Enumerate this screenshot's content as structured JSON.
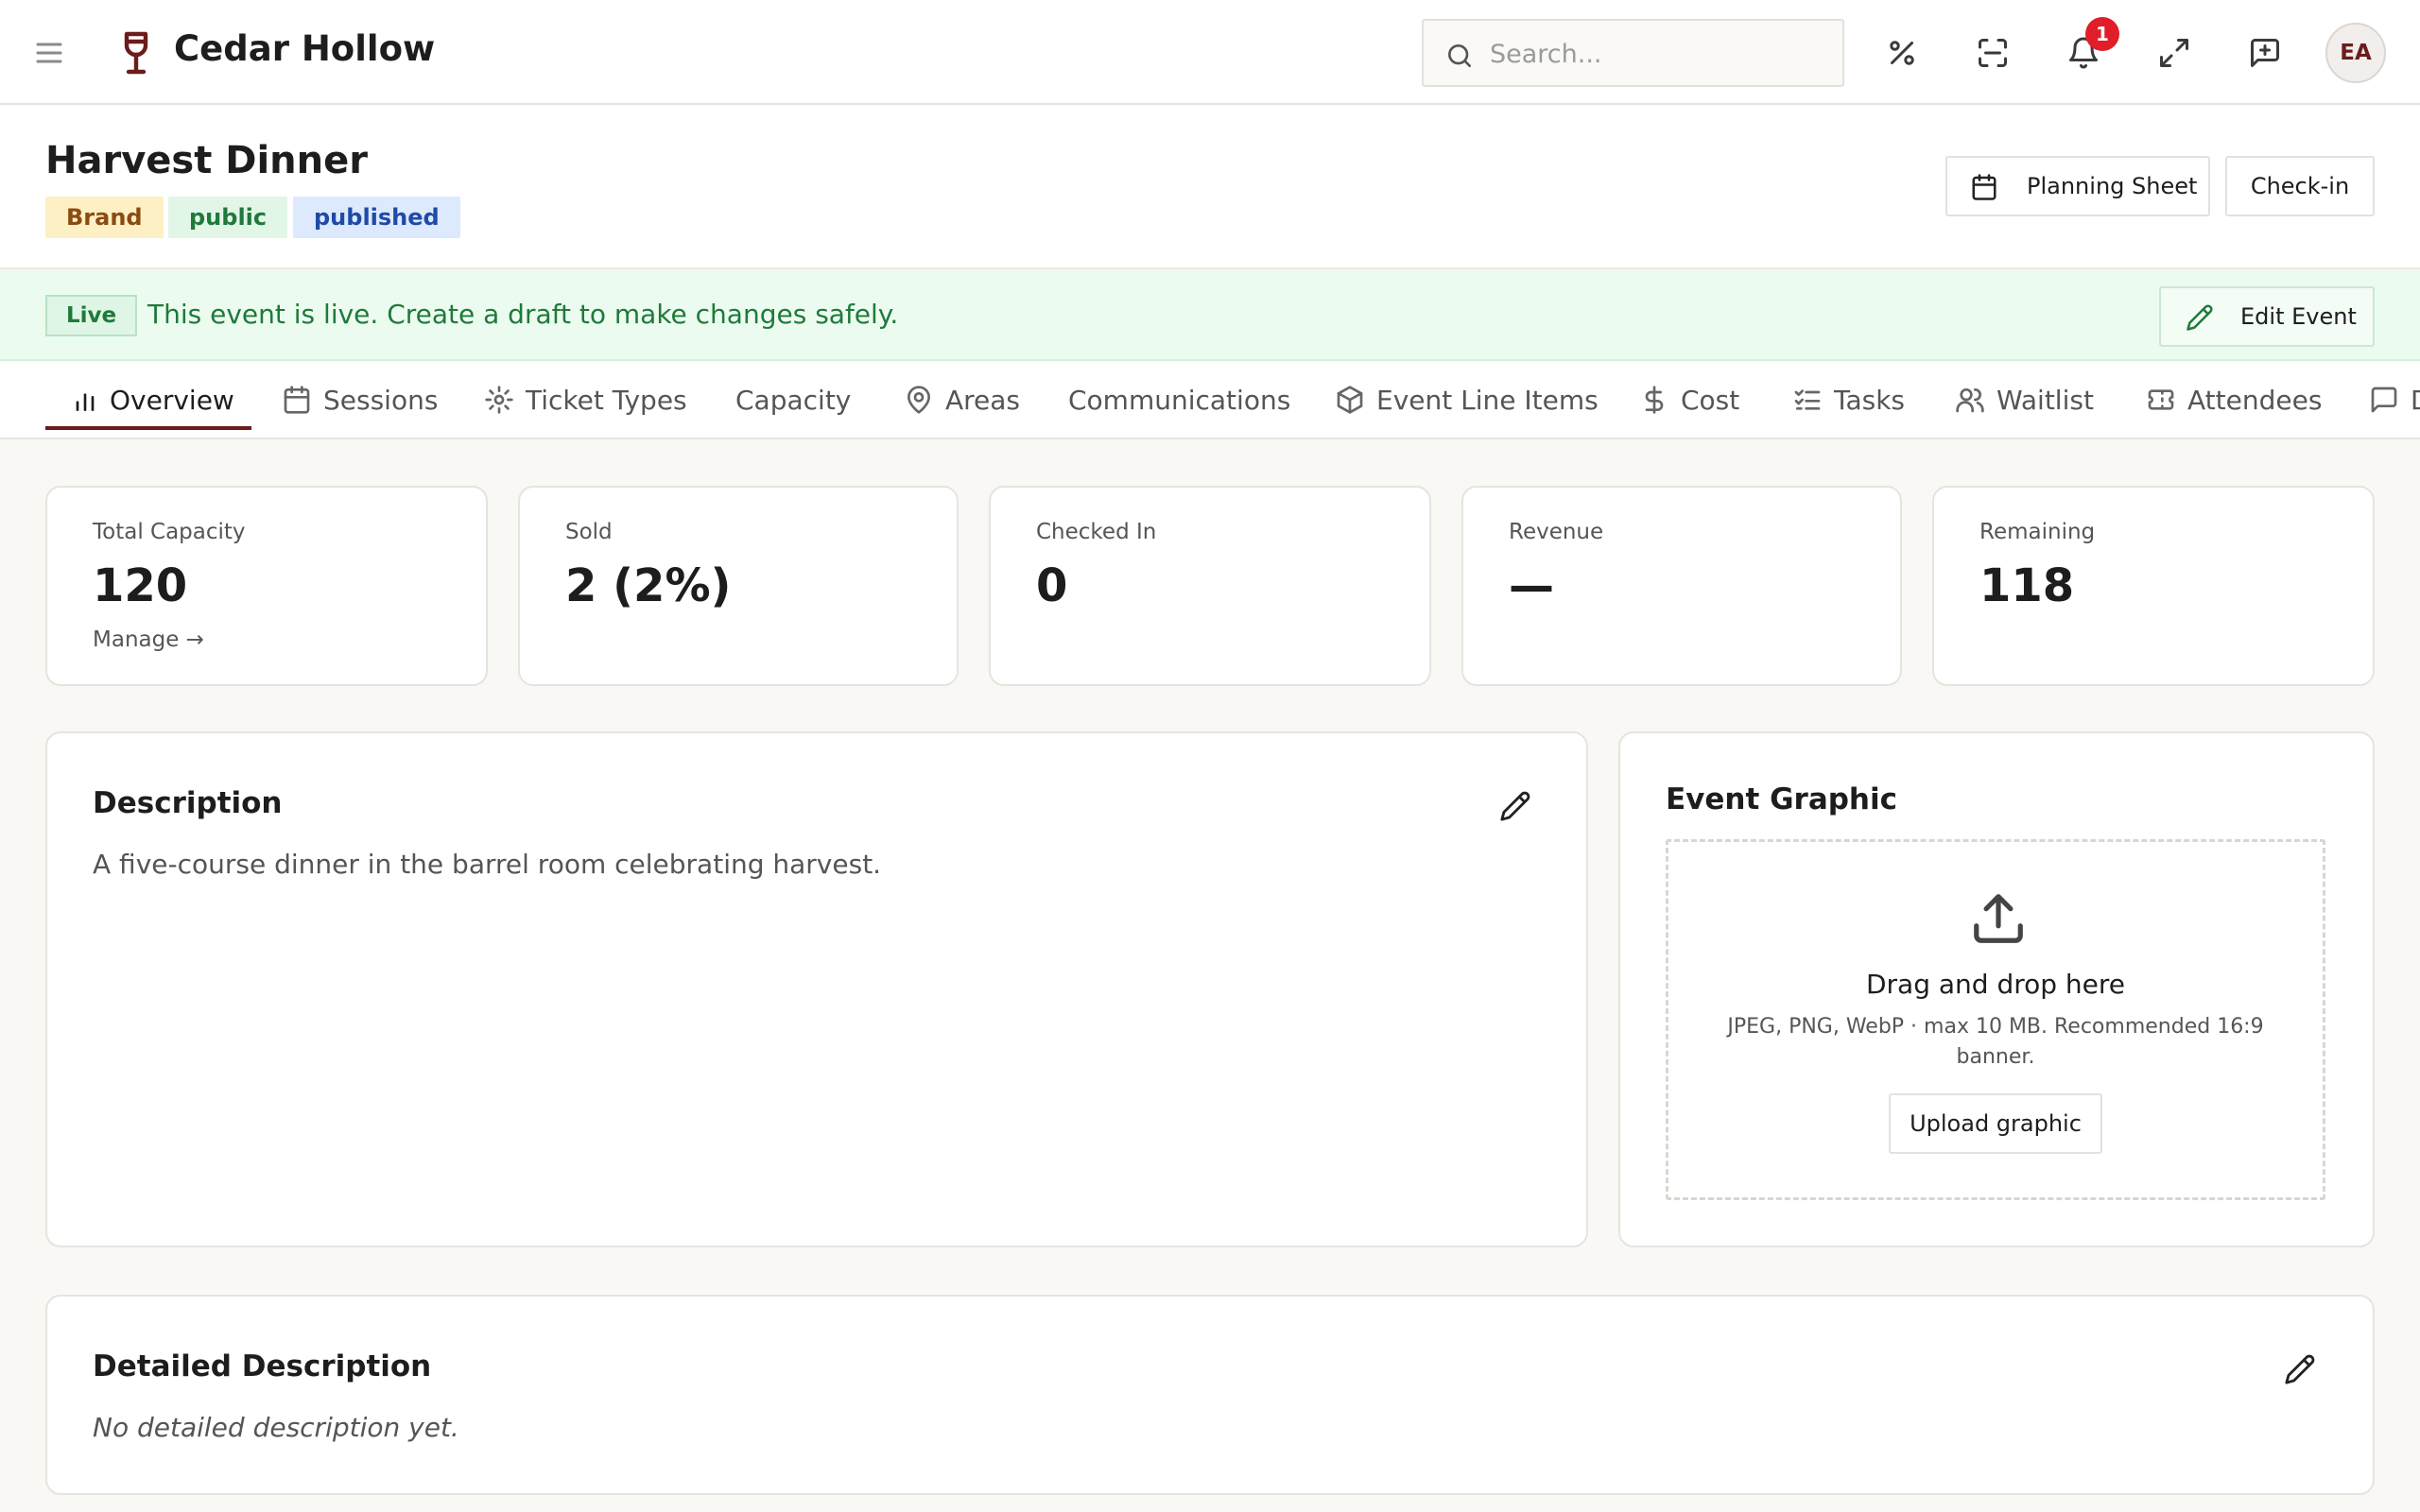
{
  "app": {
    "name": "Cedar Hollow"
  },
  "search": {
    "placeholder": "Search..."
  },
  "notifications": {
    "count": "1"
  },
  "user": {
    "initials": "EA"
  },
  "event": {
    "title": "Harvest Dinner",
    "tags": [
      "Brand",
      "public",
      "published"
    ]
  },
  "header_actions": {
    "planning_sheet": "Planning Sheet",
    "check_in": "Check-in"
  },
  "banner": {
    "chip": "Live",
    "text": "This event is live. Create a draft to make changes safely.",
    "edit_label": "Edit Event"
  },
  "tabs": [
    {
      "label": "Overview",
      "icon": "bar-chart-icon"
    },
    {
      "label": "Sessions",
      "icon": "calendar-icon"
    },
    {
      "label": "Ticket Types",
      "icon": "gear-icon"
    },
    {
      "label": "Capacity",
      "icon": ""
    },
    {
      "label": "Areas",
      "icon": "map-pin-icon"
    },
    {
      "label": "Communications",
      "icon": ""
    },
    {
      "label": "Event Line Items",
      "icon": "box-icon"
    },
    {
      "label": "Cost",
      "icon": "dollar-icon"
    },
    {
      "label": "Tasks",
      "icon": "checklist-icon"
    },
    {
      "label": "Waitlist",
      "icon": "users-icon"
    },
    {
      "label": "Attendees",
      "icon": "ticket-icon"
    },
    {
      "label": "D",
      "icon": "message-icon"
    }
  ],
  "stats": [
    {
      "label": "Total Capacity",
      "value": "120",
      "link": "Manage →"
    },
    {
      "label": "Sold",
      "value": "2 (2%)"
    },
    {
      "label": "Checked In",
      "value": "0"
    },
    {
      "label": "Revenue",
      "value": "—"
    },
    {
      "label": "Remaining",
      "value": "118"
    }
  ],
  "description": {
    "title": "Description",
    "text": "A five-course dinner in the barrel room celebrating harvest."
  },
  "graphic": {
    "title": "Event Graphic",
    "drop_title": "Drag and drop here",
    "hint": "JPEG, PNG, WebP · max 10 MB. Recommended 16:9 banner.",
    "upload_label": "Upload graphic"
  },
  "detailed": {
    "title": "Detailed Description",
    "empty": "No detailed description yet."
  },
  "colors": {
    "accent": "#6b1c1c",
    "live_green": "#1f7a3a",
    "notification_red": "#e11d2a"
  }
}
